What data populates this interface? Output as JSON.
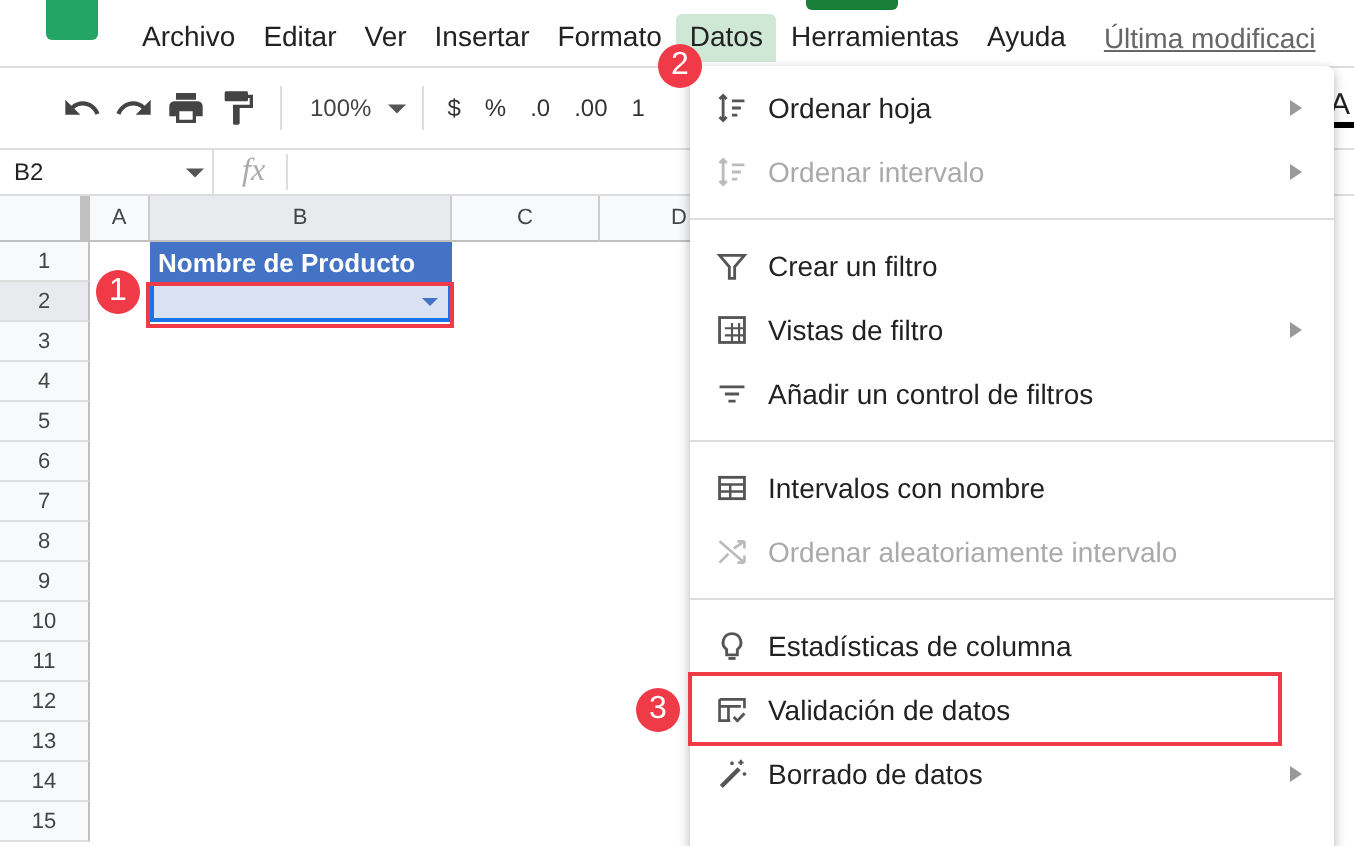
{
  "menu_bar": {
    "items": [
      {
        "label": "Archivo",
        "selected": false
      },
      {
        "label": "Editar",
        "selected": false
      },
      {
        "label": "Ver",
        "selected": false
      },
      {
        "label": "Insertar",
        "selected": false
      },
      {
        "label": "Formato",
        "selected": false
      },
      {
        "label": "Datos",
        "selected": true
      },
      {
        "label": "Herramientas",
        "selected": false
      },
      {
        "label": "Ayuda",
        "selected": false
      }
    ],
    "last_edit": "Última modificaci"
  },
  "toolbar": {
    "zoom": "100%",
    "currency": "$",
    "percent": "%",
    "decrease_decimals": ".0",
    "increase_decimals": ".00",
    "number_format": "1",
    "text_color": "A"
  },
  "formula_bar": {
    "cell_ref": "B2",
    "fx": "fx"
  },
  "sheet": {
    "columns": [
      {
        "label": "A",
        "selected": false
      },
      {
        "label": "B",
        "selected": true
      },
      {
        "label": "C",
        "selected": false
      },
      {
        "label": "D",
        "selected": false
      }
    ],
    "rows": [
      {
        "label": "1",
        "selected": false
      },
      {
        "label": "2",
        "selected": true
      },
      {
        "label": "3",
        "selected": false
      },
      {
        "label": "4",
        "selected": false
      },
      {
        "label": "5",
        "selected": false
      },
      {
        "label": "6",
        "selected": false
      },
      {
        "label": "7",
        "selected": false
      },
      {
        "label": "8",
        "selected": false
      },
      {
        "label": "9",
        "selected": false
      },
      {
        "label": "10",
        "selected": false
      },
      {
        "label": "11",
        "selected": false
      },
      {
        "label": "12",
        "selected": false
      },
      {
        "label": "13",
        "selected": false
      },
      {
        "label": "14",
        "selected": false
      },
      {
        "label": "15",
        "selected": false
      }
    ],
    "header_cell": "Nombre de Producto"
  },
  "data_menu": {
    "groups": [
      [
        {
          "label": "Ordenar hoja",
          "disabled": false,
          "submenu": true
        },
        {
          "label": "Ordenar intervalo",
          "disabled": true,
          "submenu": true
        }
      ],
      [
        {
          "label": "Crear un filtro",
          "disabled": false,
          "submenu": false
        },
        {
          "label": "Vistas de filtro",
          "disabled": false,
          "submenu": true
        },
        {
          "label": "Añadir un control de filtros",
          "disabled": false,
          "submenu": false
        }
      ],
      [
        {
          "label": "Intervalos con nombre",
          "disabled": false,
          "submenu": false
        },
        {
          "label": "Ordenar aleatoriamente intervalo",
          "disabled": true,
          "submenu": false
        }
      ],
      [
        {
          "label": "Estadísticas de columna",
          "disabled": false,
          "submenu": false
        },
        {
          "label": "Validación de datos",
          "disabled": false,
          "submenu": false
        },
        {
          "label": "Borrado de datos",
          "disabled": false,
          "submenu": true
        }
      ]
    ]
  },
  "annotations": [
    {
      "number": "1"
    },
    {
      "number": "2"
    },
    {
      "number": "3"
    }
  ]
}
